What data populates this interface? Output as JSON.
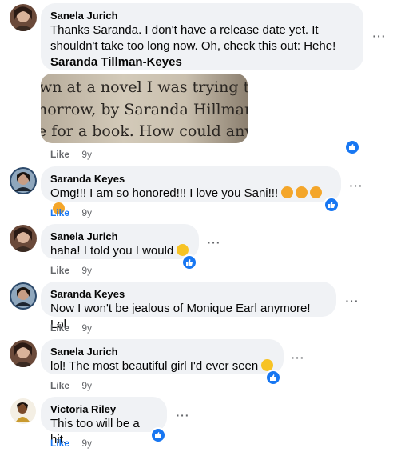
{
  "comments": [
    {
      "author": "Sanela Jurich",
      "text": "Thanks Saranda. I don't have a release date yet. It shouldn't take too long now. Oh, check this out: Hehe!",
      "mention": "Saranda Tillman-Keyes",
      "like_label": "Like",
      "time": "9y",
      "liked": false
    },
    {
      "author": "Saranda Keyes",
      "text": "Omg!!! I am so honored!!! I love you Sani!!!",
      "like_label": "Like",
      "time": "9y",
      "liked": true
    },
    {
      "author": "Sanela Jurich",
      "text": "haha! I told you I would",
      "like_label": "Like",
      "time": "9y",
      "liked": false
    },
    {
      "author": "Saranda Keyes",
      "text": "Now I won't be jealous of Monique Earl anymore! Lol",
      "like_label": "Like",
      "time": "9y",
      "liked": false
    },
    {
      "author": "Sanela Jurich",
      "text": "lol! The most beautiful girl I'd ever seen",
      "like_label": "Like",
      "time": "9y",
      "liked": false
    },
    {
      "author": "Victoria Riley",
      "text": "This too will be a hit.",
      "like_label": "Like",
      "time": "9y",
      "liked": true
    }
  ],
  "photo_text": {
    "line1": "wn at a novel I was trying to read",
    "line2": "norrow, by Saranda Hillman. I t",
    "line3": "e for a book. How could anyone"
  },
  "more_glyph": "···",
  "icons": {
    "more": "more-options-icon",
    "reaction": "like-reaction-icon",
    "emoji_smile": "smiling-face-icon",
    "emoji_kiss": "kissing-heart-face-icon"
  },
  "colors": {
    "bubble": "#f0f2f5",
    "link_blue": "#1877f2",
    "secondary_text": "#65676b",
    "emoji_yellow": "#f7c324"
  }
}
